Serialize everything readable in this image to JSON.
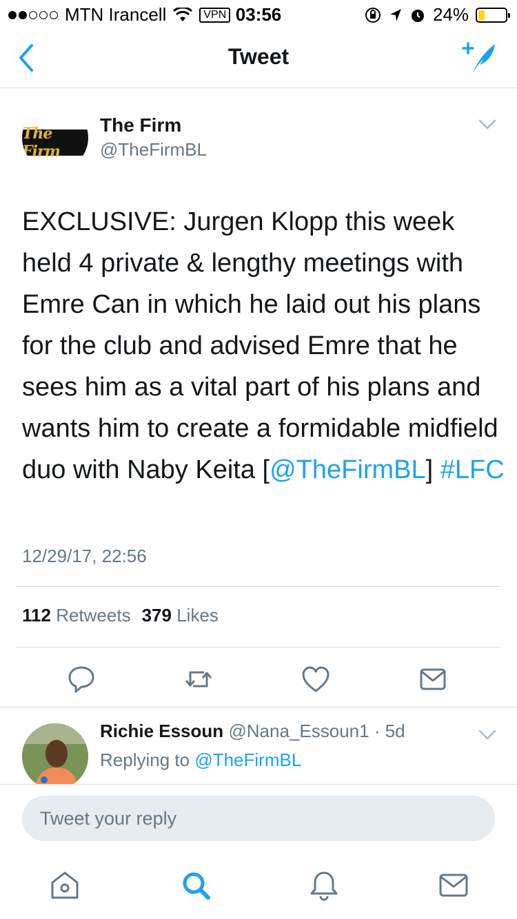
{
  "status_bar": {
    "carrier": "MTN Irancell",
    "vpn": "VPN",
    "time": "03:56",
    "battery": "24%",
    "battery_level": 0.24,
    "battery_color": "#ffd60a"
  },
  "nav": {
    "title": "Tweet"
  },
  "tweet": {
    "author_name": "The Firm",
    "author_handle": "@TheFirmBL",
    "avatar_text": "The Firm",
    "text": "EXCLUSIVE: Jurgen Klopp this week held 4 private & lengthy meetings with Emre Can in which he laid out his plans for the club and advised Emre that he sees him as a vital part of his plans and wants him to create a formidable midfield duo with Naby Keita",
    "bracket_open": "[",
    "mention": "@TheFirmBL",
    "bracket_close": "]",
    "hashtag": "#LFC",
    "timestamp": "12/29/17, 22:56",
    "retweets_count": "112",
    "retweets_label": "Retweets",
    "likes_count": "379",
    "likes_label": "Likes"
  },
  "reply": {
    "name": "Richie Essoun",
    "handle": "@Nana_Essoun1",
    "separator": " · ",
    "time": "5d",
    "replying_to_label": "Replying to",
    "replying_to_handle": "@TheFirmBL"
  },
  "reply_bar": {
    "placeholder": "Tweet your reply"
  },
  "colors": {
    "accent": "#1da1f2",
    "secondary_text": "#657786",
    "divider": "#d6d9db"
  },
  "icons": [
    "back-icon",
    "compose-icon",
    "caret-down-icon",
    "reply-icon",
    "retweet-icon",
    "like-icon",
    "message-icon",
    "home-icon",
    "search-icon",
    "notifications-icon",
    "messages-icon"
  ]
}
